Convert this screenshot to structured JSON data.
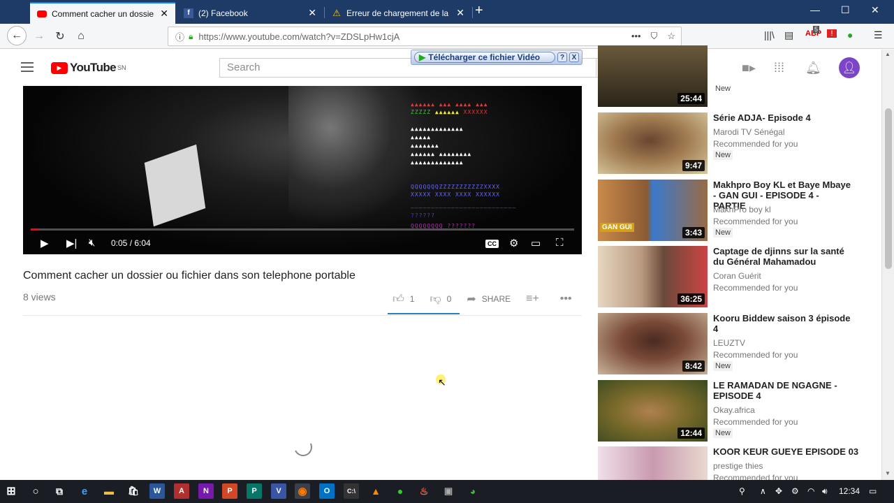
{
  "browser": {
    "tabs": [
      {
        "title": "Comment cacher un dossier ou",
        "icon": "youtube-icon",
        "active": true
      },
      {
        "title": "(2) Facebook",
        "icon": "facebook-icon",
        "active": false
      },
      {
        "title": "Erreur de chargement de la pag",
        "icon": "warning-icon",
        "active": false
      }
    ],
    "url": "https://www.youtube.com/watch?v=ZDSLpHw1cjA",
    "new_tab": "+",
    "win_minimize": "—",
    "win_maximize": "☐",
    "win_close": "✕",
    "adblock_count": "5"
  },
  "download_helper": {
    "label": "Télécharger ce fichier Vidéo",
    "help": "?",
    "close": "X"
  },
  "youtube": {
    "logo_text": "YouTube",
    "country": "SN",
    "search_placeholder": "Search"
  },
  "player": {
    "time": "0:05 / 6:04",
    "progress_fraction": 0.014,
    "cc_label": "CC"
  },
  "video": {
    "title": "Comment cacher un dossier ou fichier dans son telephone portable",
    "views": "8 views",
    "likes": "1",
    "dislikes": "0",
    "share_label": "SHARE"
  },
  "recommendations": [
    {
      "title": "",
      "channel": "",
      "reason": "",
      "badge": "New",
      "duration": "25:44"
    },
    {
      "title": "Série ADJA- Episode 4",
      "channel": "Marodi TV Sénégal",
      "reason": "Recommended for you",
      "badge": "New",
      "duration": "9:47"
    },
    {
      "title": "Makhpro Boy KL et Baye Mbaye - GAN GUI - EPISODE 4 - PARTIE",
      "channel": "MakhPro boy kl",
      "reason": "Recommended for you",
      "badge": "New",
      "duration": "3:43",
      "thumb_text": "GAN GUI"
    },
    {
      "title": "Captage de djinns sur la santé du Général Mahamadou",
      "channel": "Coran Guérit",
      "reason": "Recommended for you",
      "badge": "",
      "duration": "36:25"
    },
    {
      "title": "Kooru Biddew saison 3 épisode 4",
      "channel": "LEUZTV",
      "reason": "Recommended for you",
      "badge": "New",
      "duration": "8:42"
    },
    {
      "title": "LE RAMADAN DE NGAGNE - EPISODE 4",
      "channel": "Okay.africa",
      "reason": "Recommended for you",
      "badge": "New",
      "duration": "12:44"
    },
    {
      "title": "KOOR KEUR GUEYE EPISODE 03",
      "channel": "prestige thies",
      "reason": "Recommended for you",
      "badge": "",
      "duration": ""
    }
  ],
  "taskbar": {
    "clock": "12:34",
    "apps": [
      "start",
      "cortana",
      "task-view",
      "edge",
      "explorer",
      "store",
      "word",
      "acrobat",
      "onenote",
      "powerpoint",
      "publisher",
      "visio",
      "firefox",
      "outlook",
      "cmd",
      "vlc",
      "green-app",
      "torch-app",
      "photo-app",
      "chrome"
    ]
  },
  "colors": {
    "tabbar": "#1e3a67",
    "youtube_red": "#ff0000",
    "like_accent": "#2680c2",
    "avatar": "#7b44c9"
  }
}
